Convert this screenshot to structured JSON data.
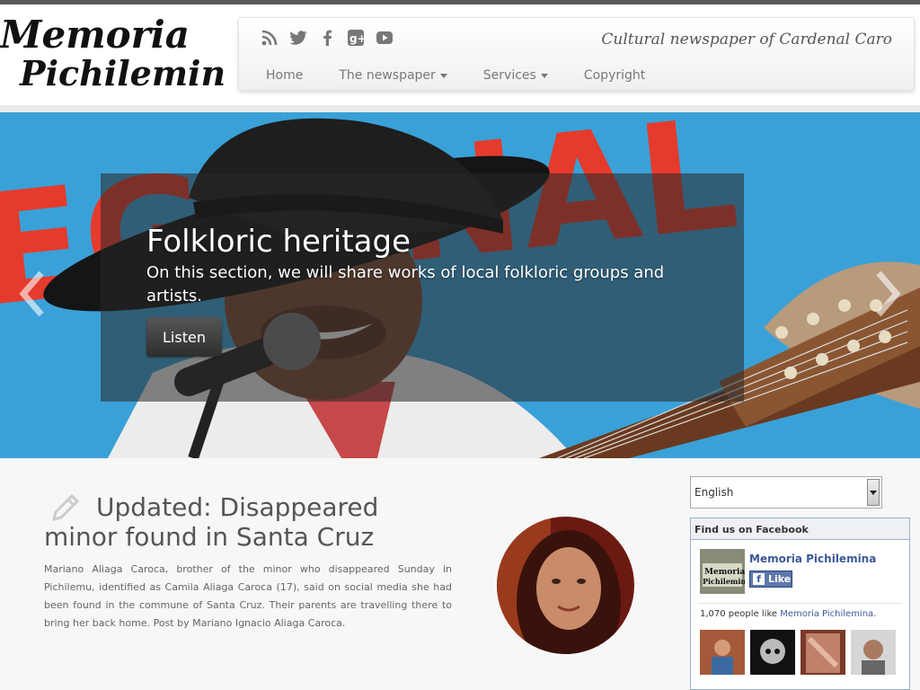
{
  "logo": {
    "line1": "Memoria",
    "line2": "Pichilemina"
  },
  "social": {
    "icons": [
      "rss-icon",
      "twitter-icon",
      "facebook-icon",
      "google-plus-icon",
      "youtube-icon"
    ]
  },
  "tagline": "Cultural newspaper of Cardenal Caro",
  "nav": {
    "home": "Home",
    "newspaper": "The newspaper",
    "services": "Services",
    "copyright": "Copyright"
  },
  "hero": {
    "banner_text": "EGIONAL",
    "title": "Folkloric heritage",
    "text": "On this section, we will share works of local folkloric groups and artists.",
    "button": "Listen"
  },
  "article": {
    "title": "Updated: Disappeared minor found in Santa Cruz",
    "body": "Mariano Aliaga Caroca, brother of the minor who disappeared Sunday in Pichilemu, identified as Camila Aliaga Caroca (17), said on social media she had been found in the commune of Santa Cruz. Their parents are travelling there to bring her back home. Post by Mariano Ignacio Aliaga Caroca."
  },
  "sidebar": {
    "language": "English",
    "facebook": {
      "header": "Find us on Facebook",
      "page_name": "Memoria Pichilemina",
      "like_label": "Like",
      "fb_letter": "f",
      "count_prefix": "1,070 people like ",
      "count_link": "Memoria Pichilemina",
      "count_suffix": "."
    }
  },
  "colors": {
    "hero_sky": "#3aa1d8",
    "banner_red": "#e53b2c",
    "facebook_blue": "#3b5998"
  }
}
